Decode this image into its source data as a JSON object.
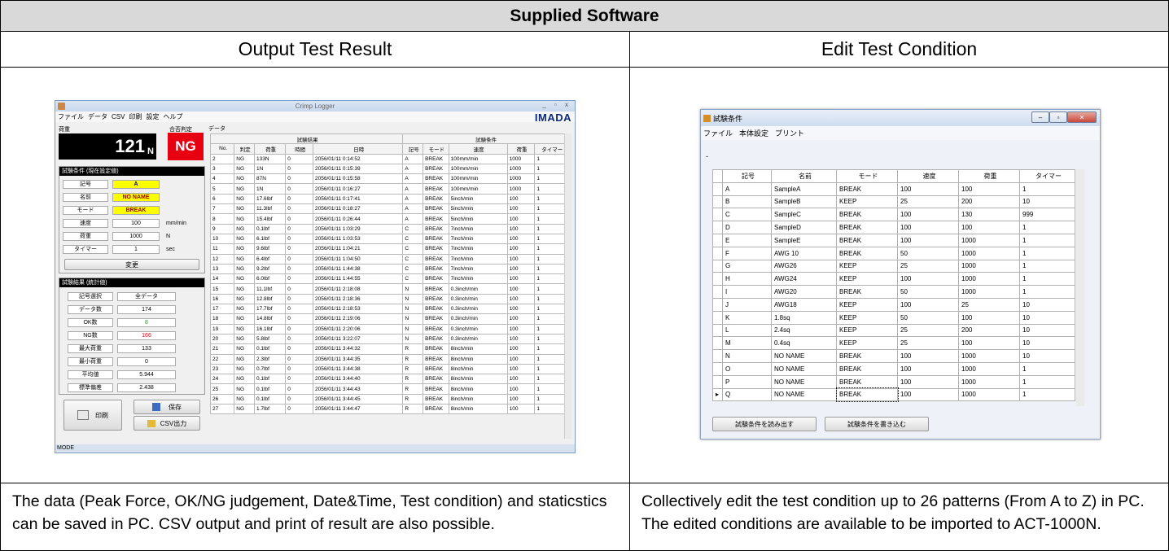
{
  "header": {
    "title": "Supplied Software",
    "left_heading": "Output Test Result",
    "right_heading": "Edit Test Condition"
  },
  "descriptions": {
    "left": "The data (Peak Force, OK/NG judgement, Date&Time, Test condition) and staticstics can be saved in PC. CSV output and print of result are also possible.",
    "right": "Collectively edit the test condition up to 26 patterns (From A to Z) in PC. The edited conditions are available to be imported to ACT-1000N."
  },
  "logger": {
    "title": "Crimp Logger",
    "window_controls": "_ ▫ x",
    "menu": [
      "ファイル",
      "データ",
      "CSV",
      "印刷",
      "設定",
      "ヘルプ"
    ],
    "logo": "IMADA",
    "force_label": "荷重",
    "judge_label": "合否判定",
    "force_value": "121",
    "force_unit": "N",
    "judge_value": "NG",
    "cond_header": "試験条件 (現在設定値)",
    "cond": [
      {
        "k": "記号",
        "v": "A",
        "u": ""
      },
      {
        "k": "名前",
        "v": "NO NAME",
        "u": ""
      },
      {
        "k": "モード",
        "v": "BREAK",
        "u": ""
      },
      {
        "k": "速度",
        "v": "100",
        "u": "mm/min"
      },
      {
        "k": "荷重",
        "v": "1000",
        "u": "N"
      },
      {
        "k": "タイマー",
        "v": "1",
        "u": "sec"
      }
    ],
    "change_btn": "変更",
    "stats_header": "試験結果 (統計値)",
    "stats": [
      {
        "k": "記号選択",
        "v": "全データ"
      },
      {
        "k": "データ数",
        "v": "174"
      },
      {
        "k": "OK数",
        "v": "8"
      },
      {
        "k": "NG数",
        "v": "166"
      },
      {
        "k": "最大荷重",
        "v": "133"
      },
      {
        "k": "最小荷重",
        "v": "0"
      },
      {
        "k": "平均値",
        "v": "5.944"
      },
      {
        "k": "標準偏差",
        "v": "2.438"
      }
    ],
    "print_btn": "印刷",
    "save_btn": "保存",
    "csv_btn": "CSV出力",
    "status": "MODE",
    "data_label": "データ",
    "group_result": "試験結果",
    "group_cond": "試験条件",
    "columns": [
      "No.",
      "判定",
      "荷重",
      "時間",
      "日時",
      "記号",
      "モード",
      "速度",
      "荷重",
      "タイマー"
    ],
    "rows": [
      [
        "2",
        "NG",
        "133N",
        "0",
        "2056/01/11 0:14:52",
        "A",
        "BREAK",
        "100mm/min",
        "1000",
        "1"
      ],
      [
        "3",
        "NG",
        "1N",
        "0",
        "2056/01/11 0:15:39",
        "A",
        "BREAK",
        "100mm/min",
        "1000",
        "1"
      ],
      [
        "4",
        "NG",
        "87N",
        "0",
        "2056/01/11 0:15:58",
        "A",
        "BREAK",
        "100mm/min",
        "1000",
        "1"
      ],
      [
        "5",
        "NG",
        "1N",
        "0",
        "2056/01/11 0:16:27",
        "A",
        "BREAK",
        "100mm/min",
        "1000",
        "1"
      ],
      [
        "6",
        "NG",
        "17.6lbf",
        "0",
        "2056/01/11 0:17:41",
        "A",
        "BREAK",
        "5inch/min",
        "100",
        "1"
      ],
      [
        "7",
        "NG",
        "11.3lbf",
        "0",
        "2056/01/11 0:18:27",
        "A",
        "BREAK",
        "5inch/min",
        "100",
        "1"
      ],
      [
        "8",
        "NG",
        "15.4lbf",
        "0",
        "2056/01/11 0:26:44",
        "A",
        "BREAK",
        "5inch/min",
        "100",
        "1"
      ],
      [
        "9",
        "NG",
        "0.1lbf",
        "0",
        "2056/01/11 1:03:29",
        "C",
        "BREAK",
        "7inch/min",
        "100",
        "1"
      ],
      [
        "10",
        "NG",
        "6.1lbf",
        "0",
        "2056/01/11 1:03:53",
        "C",
        "BREAK",
        "7inch/min",
        "100",
        "1"
      ],
      [
        "11",
        "NG",
        "9.6lbf",
        "0",
        "2056/01/11 1:04:21",
        "C",
        "BREAK",
        "7inch/min",
        "100",
        "1"
      ],
      [
        "12",
        "NG",
        "6.4lbf",
        "0",
        "2056/01/11 1:04:50",
        "C",
        "BREAK",
        "7inch/min",
        "100",
        "1"
      ],
      [
        "13",
        "NG",
        "9.2lbf",
        "0",
        "2056/01/11 1:44:38",
        "C",
        "BREAK",
        "7inch/min",
        "100",
        "1"
      ],
      [
        "14",
        "NG",
        "6.0lbf",
        "0",
        "2056/01/11 1:44:55",
        "C",
        "BREAK",
        "7inch/min",
        "100",
        "1"
      ],
      [
        "15",
        "NG",
        "11.1lbf",
        "0",
        "2056/01/11 2:18:08",
        "N",
        "BREAK",
        "0.3inch/min",
        "100",
        "1"
      ],
      [
        "16",
        "NG",
        "12.8lbf",
        "0",
        "2056/01/11 2:18:36",
        "N",
        "BREAK",
        "0.3inch/min",
        "100",
        "1"
      ],
      [
        "17",
        "NG",
        "17.7lbf",
        "0",
        "2056/01/11 2:18:53",
        "N",
        "BREAK",
        "0.3inch/min",
        "100",
        "1"
      ],
      [
        "18",
        "NG",
        "14.8lbf",
        "0",
        "2056/01/11 2:19:06",
        "N",
        "BREAK",
        "0.3inch/min",
        "100",
        "1"
      ],
      [
        "19",
        "NG",
        "16.1lbf",
        "0",
        "2056/01/11 2:20:06",
        "N",
        "BREAK",
        "0.3inch/min",
        "100",
        "1"
      ],
      [
        "20",
        "NG",
        "5.8lbf",
        "0",
        "2056/01/11 3:22:07",
        "N",
        "BREAK",
        "0.3inch/min",
        "100",
        "1"
      ],
      [
        "21",
        "NG",
        "0.1lbf",
        "0",
        "2056/01/11 3:44:32",
        "R",
        "BREAK",
        "8inch/min",
        "100",
        "1"
      ],
      [
        "22",
        "NG",
        "2.3lbf",
        "0",
        "2056/01/11 3:44:35",
        "R",
        "BREAK",
        "8inch/min",
        "100",
        "1"
      ],
      [
        "23",
        "NG",
        "0.7lbf",
        "0",
        "2056/01/11 3:44:38",
        "R",
        "BREAK",
        "8inch/min",
        "100",
        "1"
      ],
      [
        "24",
        "NG",
        "0.1lbf",
        "0",
        "2056/01/11 3:44:40",
        "R",
        "BREAK",
        "8inch/min",
        "100",
        "1"
      ],
      [
        "25",
        "NG",
        "0.1lbf",
        "0",
        "2056/01/11 3:44:43",
        "R",
        "BREAK",
        "8inch/min",
        "100",
        "1"
      ],
      [
        "26",
        "NG",
        "0.1lbf",
        "0",
        "2056/01/11 3:44:45",
        "R",
        "BREAK",
        "8inch/min",
        "100",
        "1"
      ],
      [
        "27",
        "NG",
        "1.7lbf",
        "0",
        "2056/01/11 3:44:47",
        "R",
        "BREAK",
        "8inch/min",
        "100",
        "1"
      ]
    ]
  },
  "editor": {
    "title": "試験条件",
    "menu": [
      "ファイル",
      "本体設定",
      "プリント"
    ],
    "dash": "-",
    "columns": [
      "記号",
      "名前",
      "モード",
      "速度",
      "荷重",
      "タイマー"
    ],
    "rows": [
      [
        "A",
        "SampleA",
        "BREAK",
        "100",
        "100",
        "1"
      ],
      [
        "B",
        "SampleB",
        "KEEP",
        "25",
        "200",
        "10"
      ],
      [
        "C",
        "SampleC",
        "BREAK",
        "100",
        "130",
        "999"
      ],
      [
        "D",
        "SampleD",
        "BREAK",
        "100",
        "100",
        "1"
      ],
      [
        "E",
        "SampleE",
        "BREAK",
        "100",
        "1000",
        "1"
      ],
      [
        "F",
        "AWG 10",
        "BREAK",
        "50",
        "1000",
        "1"
      ],
      [
        "G",
        "AWG26",
        "KEEP",
        "25",
        "1000",
        "1"
      ],
      [
        "H",
        "AWG24",
        "KEEP",
        "100",
        "1000",
        "1"
      ],
      [
        "I",
        "AWG20",
        "BREAK",
        "50",
        "1000",
        "1"
      ],
      [
        "J",
        "AWG18",
        "KEEP",
        "100",
        "25",
        "10"
      ],
      [
        "K",
        "1.8sq",
        "KEEP",
        "50",
        "100",
        "10"
      ],
      [
        "L",
        "2.4sq",
        "KEEP",
        "25",
        "200",
        "10"
      ],
      [
        "M",
        "0.4sq",
        "KEEP",
        "25",
        "100",
        "10"
      ],
      [
        "N",
        "NO NAME",
        "BREAK",
        "100",
        "1000",
        "10"
      ],
      [
        "O",
        "NO NAME",
        "BREAK",
        "100",
        "1000",
        "1"
      ],
      [
        "P",
        "NO NAME",
        "BREAK",
        "100",
        "1000",
        "1"
      ],
      [
        "Q",
        "NO NAME",
        "BREAK",
        "100",
        "1000",
        "1"
      ]
    ],
    "read_btn": "試験条件を読み出す",
    "write_btn": "試験条件を書き込む"
  },
  "colors": {
    "ng_red": "#e60012",
    "highlight_yellow": "#ffff00",
    "header_gray": "#d9d9d9",
    "ok_green": "#2a9d2a"
  }
}
